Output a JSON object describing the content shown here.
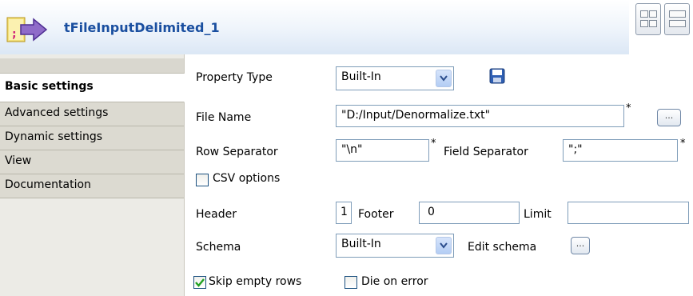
{
  "header": {
    "title": "tFileInputDelimited_1",
    "icon": "file-input-arrow-icon"
  },
  "sidebar": {
    "items": [
      {
        "label": "Basic settings",
        "active": true
      },
      {
        "label": "Advanced settings"
      },
      {
        "label": "Dynamic settings"
      },
      {
        "label": "View"
      },
      {
        "label": "Documentation"
      }
    ]
  },
  "form": {
    "property_type_label": "Property Type",
    "property_type_value": "Built-In",
    "file_name_label": "File Name",
    "file_name_value": "\"D:/Input/Denormalize.txt\"",
    "row_separator_label": "Row Separator",
    "row_separator_value": "\"\\n\"",
    "field_separator_label": "Field Separator",
    "field_separator_value": "\";\"",
    "csv_options_label": "CSV options",
    "csv_options_checked": false,
    "header_label": "Header",
    "header_value": "1",
    "footer_label": "Footer",
    "footer_value": "0",
    "limit_label": "Limit",
    "limit_value": "",
    "schema_label": "Schema",
    "schema_value": "Built-In",
    "edit_schema_label": "Edit schema",
    "skip_empty_rows_label": "Skip empty rows",
    "skip_empty_rows_checked": true,
    "die_on_error_label": "Die on error",
    "die_on_error_checked": false,
    "required_mark": "*",
    "ellipsis": "..."
  },
  "colors": {
    "title": "#1a4fa0",
    "field_border": "#7f9db9",
    "sidebar_bg": "#dcdad1",
    "checkbox_border": "#1c5180",
    "check_mark": "#21a121"
  }
}
